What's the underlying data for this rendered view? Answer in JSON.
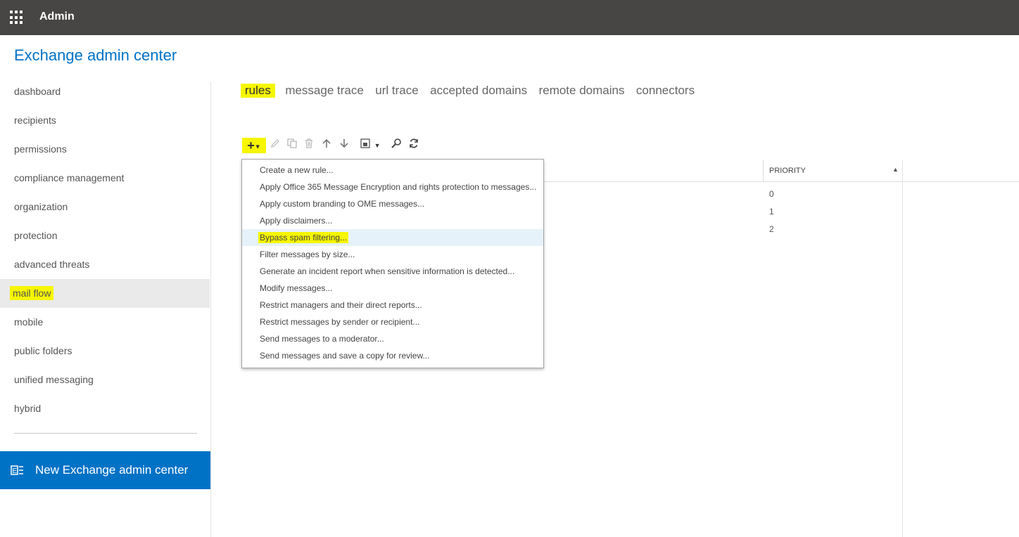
{
  "header": {
    "title": "Admin"
  },
  "app": {
    "title": "Exchange admin center"
  },
  "sidebar": {
    "items": [
      {
        "label": "dashboard"
      },
      {
        "label": "recipients"
      },
      {
        "label": "permissions"
      },
      {
        "label": "compliance management"
      },
      {
        "label": "organization"
      },
      {
        "label": "protection"
      },
      {
        "label": "advanced threats"
      },
      {
        "label": "mail flow"
      },
      {
        "label": "mobile"
      },
      {
        "label": "public folders"
      },
      {
        "label": "unified messaging"
      },
      {
        "label": "hybrid"
      }
    ],
    "active": "mail flow",
    "new_eac": "New Exchange admin center"
  },
  "tabs": [
    {
      "label": "rules"
    },
    {
      "label": "message trace"
    },
    {
      "label": "url trace"
    },
    {
      "label": "accepted domains"
    },
    {
      "label": "remote domains"
    },
    {
      "label": "connectors"
    }
  ],
  "toolbar": {
    "add_glyph": "+",
    "icons": [
      "add-icon",
      "edit-icon",
      "copy-icon",
      "delete-icon",
      "move-up-icon",
      "move-down-icon",
      "export-icon",
      "search-icon",
      "refresh-icon"
    ]
  },
  "grid": {
    "columns": [
      {
        "label": "PRIORITY"
      }
    ],
    "priorities": [
      "0",
      "1",
      "2"
    ]
  },
  "menu": {
    "items": [
      {
        "label": "Create a new rule..."
      },
      {
        "label": "Apply Office 365 Message Encryption and rights protection to messages..."
      },
      {
        "label": "Apply custom branding to OME messages..."
      },
      {
        "label": "Apply disclaimers..."
      },
      {
        "label": "Bypass spam filtering..."
      },
      {
        "label": "Filter messages by size..."
      },
      {
        "label": "Generate an incident report when sensitive information is detected..."
      },
      {
        "label": "Modify messages..."
      },
      {
        "label": "Restrict managers and their direct reports..."
      },
      {
        "label": "Restrict messages by sender or recipient..."
      },
      {
        "label": "Send messages to a moderator..."
      },
      {
        "label": "Send messages and save a copy for review..."
      }
    ],
    "highlighted": "Bypass spam filtering..."
  },
  "colors": {
    "topbar": "#484644",
    "accent": "#0072c6",
    "highlight": "#f6f600",
    "menu_hover": "#e6f2fa"
  }
}
